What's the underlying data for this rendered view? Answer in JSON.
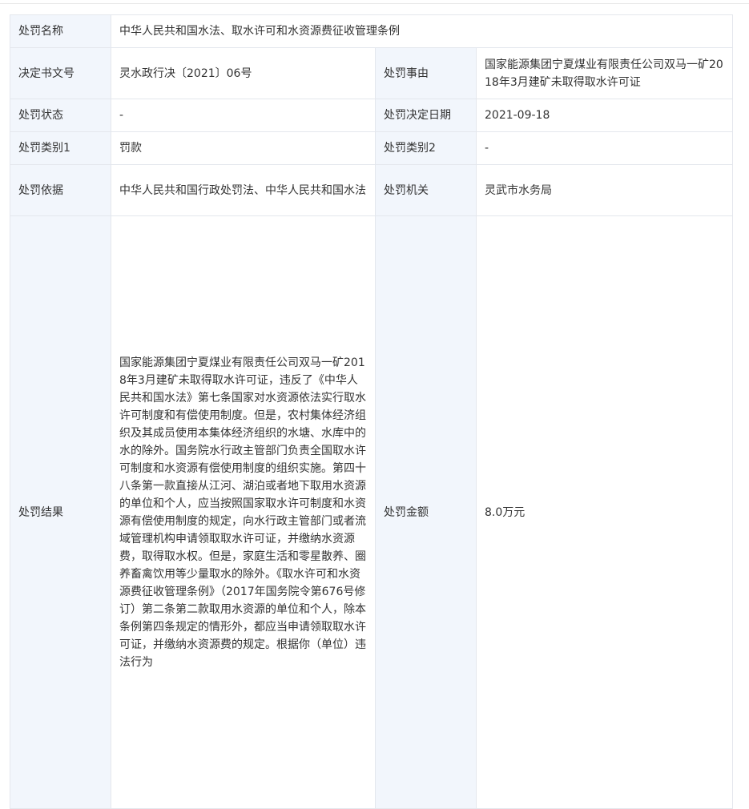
{
  "rows": {
    "name": {
      "label": "处罚名称",
      "value": "中华人民共和国水法、取水许可和水资源费征收管理条例"
    },
    "doc_no": {
      "label": "决定书文号",
      "value": "灵水政行决〔2021〕06号"
    },
    "reason": {
      "label": "处罚事由",
      "value": "国家能源集团宁夏煤业有限责任公司双马一矿2018年3月建矿未取得取水许可证"
    },
    "status": {
      "label": "处罚状态",
      "value": "-"
    },
    "date": {
      "label": "处罚决定日期",
      "value": "2021-09-18"
    },
    "type1": {
      "label": "处罚类别1",
      "value": "罚款"
    },
    "type2": {
      "label": "处罚类别2",
      "value": "-"
    },
    "basis": {
      "label": "处罚依据",
      "value": "中华人民共和国行政处罚法、中华人民共和国水法"
    },
    "authority": {
      "label": "处罚机关",
      "value": "灵武市水务局"
    },
    "result": {
      "label": "处罚结果",
      "value": "国家能源集团宁夏煤业有限责任公司双马一矿2018年3月建矿未取得取水许可证，违反了《中华人民共和国水法》第七条国家对水资源依法实行取水许可制度和有偿使用制度。但是，农村集体经济组织及其成员使用本集体经济组织的水塘、水库中的水的除外。国务院水行政主管部门负责全国取水许可制度和水资源有偿使用制度的组织实施。第四十八条第一款直接从江河、湖泊或者地下取用水资源的单位和个人，应当按照国家取水许可制度和水资源有偿使用制度的规定，向水行政主管部门或者流域管理机构申请领取取水许可证，并缴纳水资源费，取得取水权。但是，家庭生活和零星散养、圈养畜禽饮用等少量取水的除外。《取水许可和水资源费征收管理条例》（2017年国务院令第676号修订）第二条第二款取用水资源的单位和个人，除本条例第四条规定的情形外，都应当申请领取取水许可证，并缴纳水资源费的规定。根据你（单位）违法行为"
    },
    "amount": {
      "label": "处罚金额",
      "value": "8.0万元"
    }
  }
}
